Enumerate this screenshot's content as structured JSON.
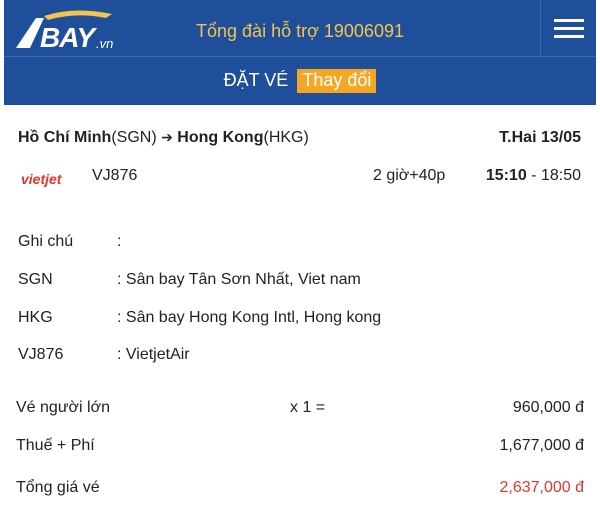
{
  "header": {
    "logo_text": "BAY",
    "logo_suffix": ".vn",
    "hotline": "Tổng đài hỗ trợ 19006091",
    "menu_icon": "hamburger-menu-icon",
    "bg_color": "#1f4e9a",
    "accent_color": "#f5c54b"
  },
  "subbar": {
    "title": "ĐẶT VÉ",
    "change_label": "Thay đổi"
  },
  "flight": {
    "from_city": "Hồ Chí Minh",
    "from_code": "(SGN)",
    "arrow": "➔",
    "to_city": "Hong Kong",
    "to_code": "(HKG)",
    "date": "T.Hai 13/05",
    "airline_logo_text": "vietjet",
    "flight_number": "VJ876",
    "duration": "2 giờ+40p",
    "depart_time": "15:10",
    "arrive_time": " - 18:50"
  },
  "info": [
    {
      "label": "Ghi chú",
      "value": ":"
    },
    {
      "label": "SGN",
      "value": ": Sân bay Tân Sơn Nhất, Viet nam"
    },
    {
      "label": "HKG",
      "value": ": Sân bay Hong Kong Intl, Hong kong"
    },
    {
      "label": "VJ876",
      "value": ": VietjetAir"
    }
  ],
  "prices": {
    "adult_label": "Vé người lớn",
    "adult_qty": "x 1 =",
    "adult_value": "960,000 đ",
    "tax_label": "Thuế + Phí",
    "tax_value": "1,677,000 đ",
    "total_label": "Tổng giá vé",
    "total_value": "2,637,000 đ",
    "total_color": "#e0362b"
  }
}
